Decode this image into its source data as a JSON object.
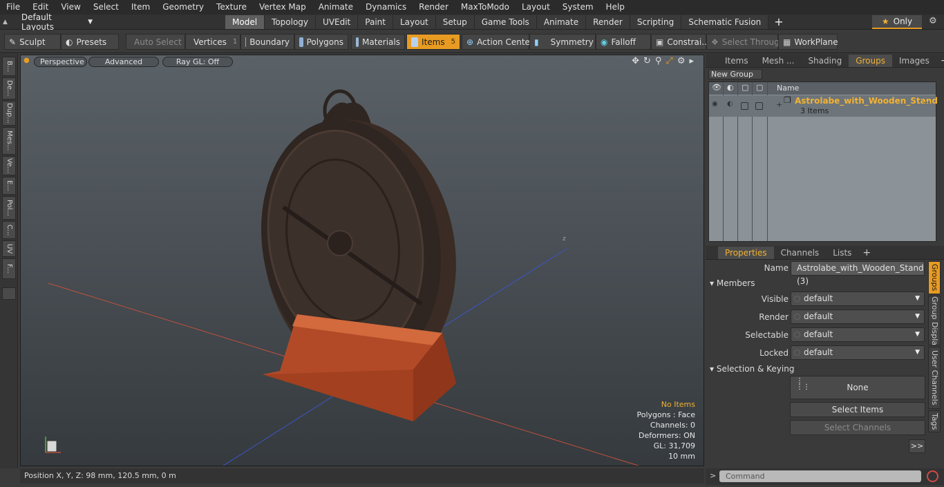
{
  "menu": [
    "File",
    "Edit",
    "View",
    "Select",
    "Item",
    "Geometry",
    "Texture",
    "Vertex Map",
    "Animate",
    "Dynamics",
    "Render",
    "MaxToModo",
    "Layout",
    "System",
    "Help"
  ],
  "layout_selector": "Default Layouts",
  "tabs": [
    "Model",
    "Topology",
    "UVEdit",
    "Paint",
    "Layout",
    "Setup",
    "Game Tools",
    "Animate",
    "Render",
    "Scripting",
    "Schematic Fusion"
  ],
  "tab_add": "+",
  "only_label": "Only",
  "toolbar": {
    "sculpt": "Sculpt",
    "presets": "Presets",
    "auto_select": "Auto Select",
    "vertices": "Vertices",
    "vertices_count": "1",
    "boundary": "Boundary",
    "polygons": "Polygons",
    "materials": "Materials",
    "items": "Items",
    "items_count": "5",
    "action_center": "Action Center",
    "symmetry": "Symmetry",
    "falloff": "Falloff",
    "constraints": "Constrai...",
    "select_through": "Select Through",
    "workplane": "WorkPlane"
  },
  "left_tabs": [
    "B...",
    "De...",
    "Dup...",
    "Mes...",
    "Ve...",
    "E...",
    "Pol...",
    "C...",
    "UV",
    "F..."
  ],
  "viewport": {
    "perspective": "Perspective",
    "advanced": "Advanced",
    "raygl": "Ray GL: Off",
    "info": {
      "no_items": "No Items",
      "polygons": "Polygons : Face",
      "channels": "Channels: 0",
      "deformers": "Deformers: ON",
      "gl": "GL: 31,709",
      "scale": "10 mm"
    }
  },
  "status": "Position X, Y, Z:  98 mm, 120.5 mm, 0 m",
  "upper_tabs": [
    "Items",
    "Mesh ...",
    "Shading",
    "Groups",
    "Images"
  ],
  "upper_active": "Groups",
  "new_group": "New Group",
  "group_list": {
    "name_header": "Name",
    "item_name": "Astrolabe_with_Wooden_Stand",
    "item_ellipsis": "...",
    "item_count": "3 Items"
  },
  "lower_tabs": [
    "Properties",
    "Channels",
    "Lists"
  ],
  "properties": {
    "name_label": "Name",
    "name_value": "Astrolabe_with_Wooden_Stand (3)",
    "members": "Members",
    "visible_label": "Visible",
    "render_label": "Render",
    "selectable_label": "Selectable",
    "locked_label": "Locked",
    "default_value": "default",
    "selection_keying": "Selection & Keying",
    "none": "None",
    "select_items": "Select Items",
    "select_channels": "Select Channels",
    "expand": ">>"
  },
  "side_tabs": [
    "Groups",
    "Group Display",
    "User Channels",
    "Tags"
  ],
  "command_placeholder": "Command",
  "colors": {
    "accent": "#e89b22",
    "highlight_text": "#f2b233"
  }
}
